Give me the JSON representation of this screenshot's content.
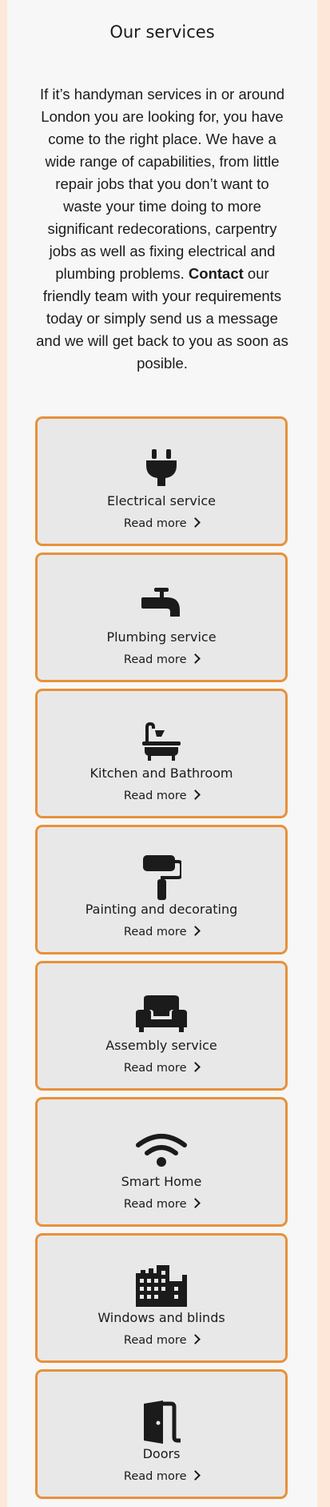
{
  "title": "Our services",
  "intro": {
    "before_link": "If it’s handyman services in or around London you are looking for, you have come to the right place. We have a wide range of capabilities, from little repair jobs that you don’t want to waste your time doing to more significant redecorations, carpentry jobs as well as fixing electrical and plumbing problems.",
    "link": "Contact",
    "after_link": "our friendly team with your requirements today or simply send us a message and we will get back to you as soon as posible."
  },
  "services": [
    {
      "name": "Electrical service",
      "read_more": "Read more",
      "icon": "plug-icon"
    },
    {
      "name": "Plumbing service",
      "read_more": "Read more",
      "icon": "faucet-icon"
    },
    {
      "name": "Kitchen and Bathroom",
      "read_more": "Read more",
      "icon": "bathtub-icon"
    },
    {
      "name": "Painting and decorating",
      "read_more": "Read more",
      "icon": "paint-roller-icon"
    },
    {
      "name": "Assembly service",
      "read_more": "Read more",
      "icon": "sofa-icon"
    },
    {
      "name": "Smart Home",
      "read_more": "Read more",
      "icon": "wifi-icon"
    },
    {
      "name": "Windows and blinds",
      "read_more": "Read more",
      "icon": "building-icon"
    },
    {
      "name": "Doors",
      "read_more": "Read more",
      "icon": "door-icon"
    }
  ],
  "colors": {
    "card_border": "#e8913a",
    "card_bg": "#e8e8e8",
    "page_bg": "#f7f7f7",
    "outer_bg": "#fde7d8",
    "text": "#1b1b1b"
  }
}
